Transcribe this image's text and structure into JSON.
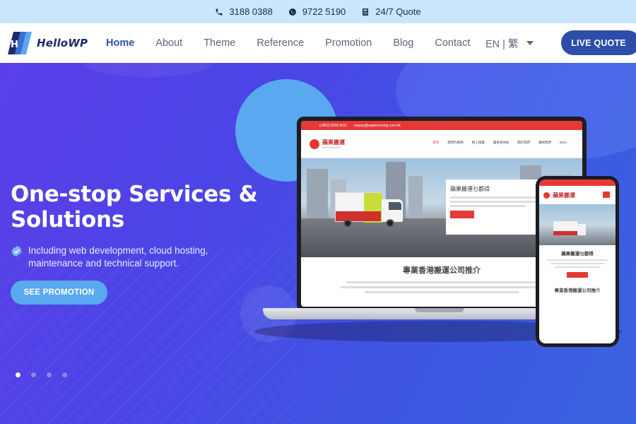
{
  "topbar": {
    "phone": "3188 0388",
    "whatsapp": "9722 5190",
    "quote": "24/7 Quote"
  },
  "header": {
    "logo_text": "HelloWP",
    "nav": [
      {
        "label": "Home",
        "active": true
      },
      {
        "label": "About"
      },
      {
        "label": "Theme"
      },
      {
        "label": "Reference"
      },
      {
        "label": "Promotion"
      },
      {
        "label": "Blog"
      },
      {
        "label": "Contact"
      }
    ],
    "language": "EN | 繁",
    "cta_label": "LIVE QUOTE"
  },
  "hero": {
    "headline": "One-stop Services & Solutions",
    "subtext": "Including web development, cloud hosting, maintenance and technical support.",
    "button_label": "SEE PROMOTION",
    "slides": 4,
    "active_slide": 1
  },
  "mockup": {
    "top_phone": "(+852) 8208 9911",
    "top_email": "inquiry@applemoving.com.hk",
    "brand_cn": "蘋果搬運",
    "brand_en": "APPLE MOVING",
    "menu": [
      "首頁",
      "我們的服務",
      "網上報價",
      "蘋果迷你倉",
      "關於我們",
      "聯絡我們",
      "ENG"
    ],
    "card_title": "蘋果搬運乜都得",
    "section_title": "專業香港搬運公司推介"
  },
  "colors": {
    "topbar_bg": "#c9e6fb",
    "brand_blue": "#2c4da8",
    "hero_gradient_start": "#5a3fe8",
    "hero_gradient_end": "#3a63df",
    "accent_light_blue": "#5aa9f0",
    "mockup_red": "#e53935"
  }
}
